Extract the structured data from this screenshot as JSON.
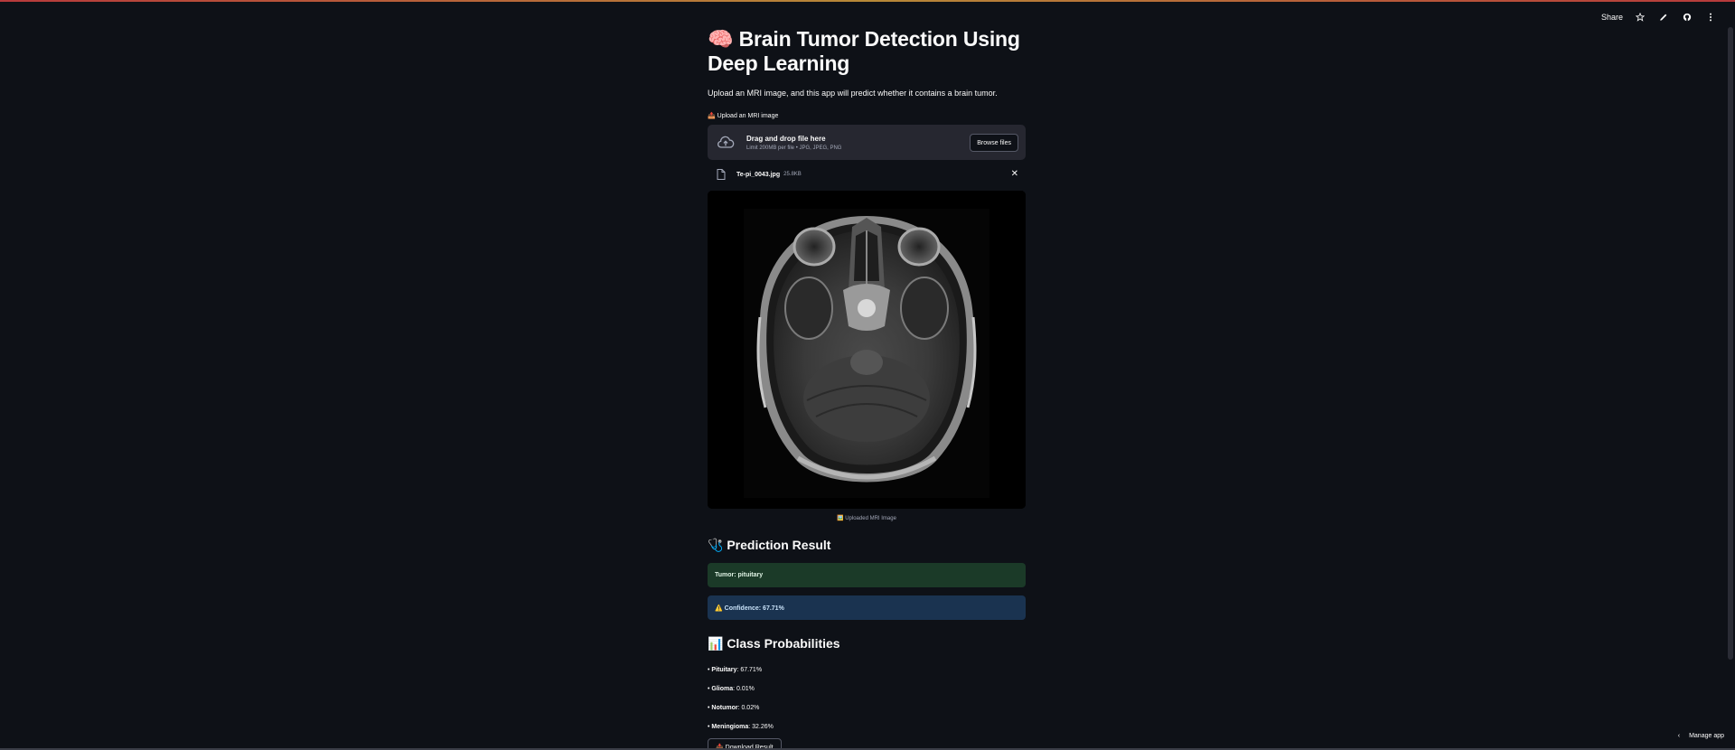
{
  "header": {
    "share_label": "Share",
    "icons": [
      "star-icon",
      "edit-icon",
      "github-icon",
      "more-icon"
    ]
  },
  "app": {
    "title": "🧠 Brain Tumor Detection Using Deep Learning",
    "subtitle": "Upload an MRI image, and this app will predict whether it contains a brain tumor."
  },
  "uploader": {
    "label": "📤 Upload an MRI image",
    "drop_text": "Drag and drop file here",
    "limit_text": "Limit 200MB per file • JPG, JPEG, PNG",
    "browse_label": "Browse files",
    "file": {
      "name": "Te-pi_0043.jpg",
      "size": "25.8KB"
    }
  },
  "image": {
    "caption": "🖼️ Uploaded MRI Image"
  },
  "prediction": {
    "heading": "🩺 Prediction Result",
    "tumor_text": "Tumor: pituitary",
    "confidence_text": "⚠️ Confidence: 67.71%"
  },
  "probabilities": {
    "heading": "📊 Class Probabilities",
    "items": [
      {
        "name": "Pituitary",
        "value": "67.71%"
      },
      {
        "name": "Glioma",
        "value": "0.01%"
      },
      {
        "name": "Notumor",
        "value": "0.02%"
      },
      {
        "name": "Meningioma",
        "value": "32.26%"
      }
    ]
  },
  "download": {
    "label": "📥 Download Result"
  },
  "footer": {
    "manage_label": "Manage app"
  },
  "colors": {
    "background": "#0e1117",
    "success_bg": "#1b3a28",
    "info_bg": "#1a3350",
    "dropzone_bg": "#262730"
  }
}
